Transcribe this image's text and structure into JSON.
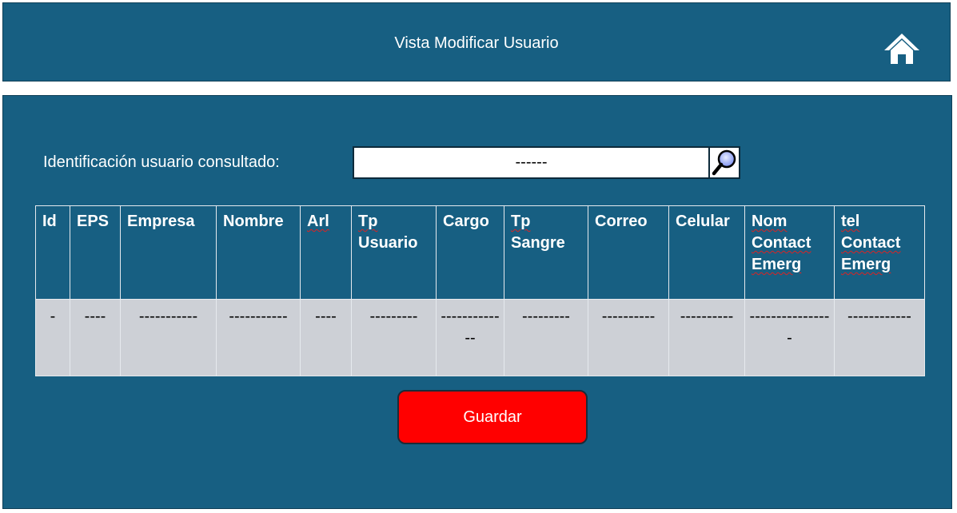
{
  "header": {
    "title": "Vista Modificar Usuario",
    "home_icon": "home-icon"
  },
  "search": {
    "label": "Identificación usuario consultado:",
    "value": "------",
    "icon": "magnifier-icon"
  },
  "table": {
    "columns": [
      {
        "key": "id",
        "label": "Id"
      },
      {
        "key": "eps",
        "label": "EPS"
      },
      {
        "key": "empresa",
        "label": "Empresa"
      },
      {
        "key": "nombre",
        "label": "Nombre"
      },
      {
        "key": "arl",
        "label": "Arl"
      },
      {
        "key": "tp_usuario_1",
        "label": "Tp"
      },
      {
        "key": "tp_usuario_2",
        "label": "Usuario"
      },
      {
        "key": "cargo",
        "label": "Cargo"
      },
      {
        "key": "tp_sangre_1",
        "label": "Tp"
      },
      {
        "key": "tp_sangre_2",
        "label": "Sangre"
      },
      {
        "key": "correo",
        "label": "Correo"
      },
      {
        "key": "celular",
        "label": "Celular"
      },
      {
        "key": "nom_1",
        "label": "Nom"
      },
      {
        "key": "nom_2",
        "label": "Contact"
      },
      {
        "key": "nom_3",
        "label": "Emerg"
      },
      {
        "key": "tel_1",
        "label": "tel"
      },
      {
        "key": "tel_2",
        "label": "Contact"
      },
      {
        "key": "tel_3",
        "label": "Emerg"
      }
    ],
    "row": {
      "id": "-",
      "eps": "----",
      "empresa": "-----------",
      "nombre": "-----------",
      "arl": "----",
      "tp_usuario": "---------",
      "cargo": "-------------",
      "tp_sangre": "---------",
      "correo": "----------",
      "celular": "----------",
      "nom_contact": "----------------",
      "tel_contact": "------------"
    }
  },
  "actions": {
    "save_label": "Guardar"
  },
  "colors": {
    "background": "#175f82",
    "row_background": "#cdd0d6",
    "save_button": "#ff0000"
  }
}
